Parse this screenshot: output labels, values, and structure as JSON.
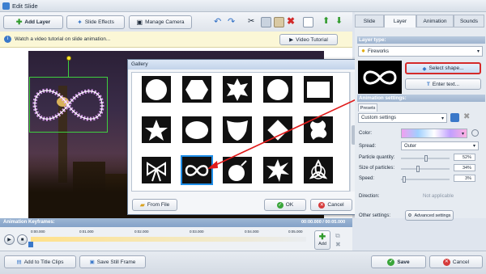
{
  "window": {
    "title": "Edit Slide"
  },
  "toolbar": {
    "add_layer": "Add Layer",
    "slide_effects": "Slide Effects",
    "manage_camera": "Manage Camera"
  },
  "notice": {
    "text": "Watch a video tutorial on slide animation...",
    "video_button": "Video Tutorial"
  },
  "gallery": {
    "title": "Gallery",
    "shapes": [
      "sunburst",
      "hexagon",
      "starburst",
      "scalloped-circle",
      "rectangle",
      "star",
      "ellipse",
      "shield",
      "warning-sign",
      "splat",
      "bow",
      "infinity",
      "bomb",
      "explosion",
      "triquetra"
    ],
    "selected": "infinity",
    "from_file": "From File",
    "ok": "OK",
    "cancel": "Cancel"
  },
  "tabs": [
    "Slide",
    "Layer",
    "Animation",
    "Sounds"
  ],
  "active_tab": "Layer",
  "layer_type": {
    "heading": "Layer type:",
    "value": "Fireworks",
    "select_shape": "Select shape...",
    "enter_text": "Enter text..."
  },
  "animation": {
    "heading": "Animation settings:",
    "presets_label": "Presets",
    "preset_value": "Custom settings",
    "color_label": "Color:",
    "spread_label": "Spread:",
    "spread_value": "Outer",
    "particle_qty_label": "Particle quantity:",
    "particle_qty_value": "52%",
    "particle_qty": 0.52,
    "size_label": "Size of particles:",
    "size_value": "34%",
    "size": 0.34,
    "speed_label": "Speed:",
    "speed_value": "3%",
    "speed": 0.03,
    "direction_label": "Direction:",
    "direction_value": "Not applicable",
    "other_label": "Other settings:",
    "advanced_button": "Advanced settings"
  },
  "keyframes": {
    "heading": "Animation Keyframes:",
    "time": "00:00.000 / 00:05.000",
    "ticks": [
      "0:00.000",
      "0:01.000",
      "0:02.000",
      "0:03.000",
      "0:04.000",
      "0:05.000"
    ],
    "add_label": "Add"
  },
  "bottom": {
    "add_title_clips": "Add to Title Clips",
    "save_still_frame": "Save Still Frame",
    "save": "Save",
    "cancel": "Cancel"
  }
}
